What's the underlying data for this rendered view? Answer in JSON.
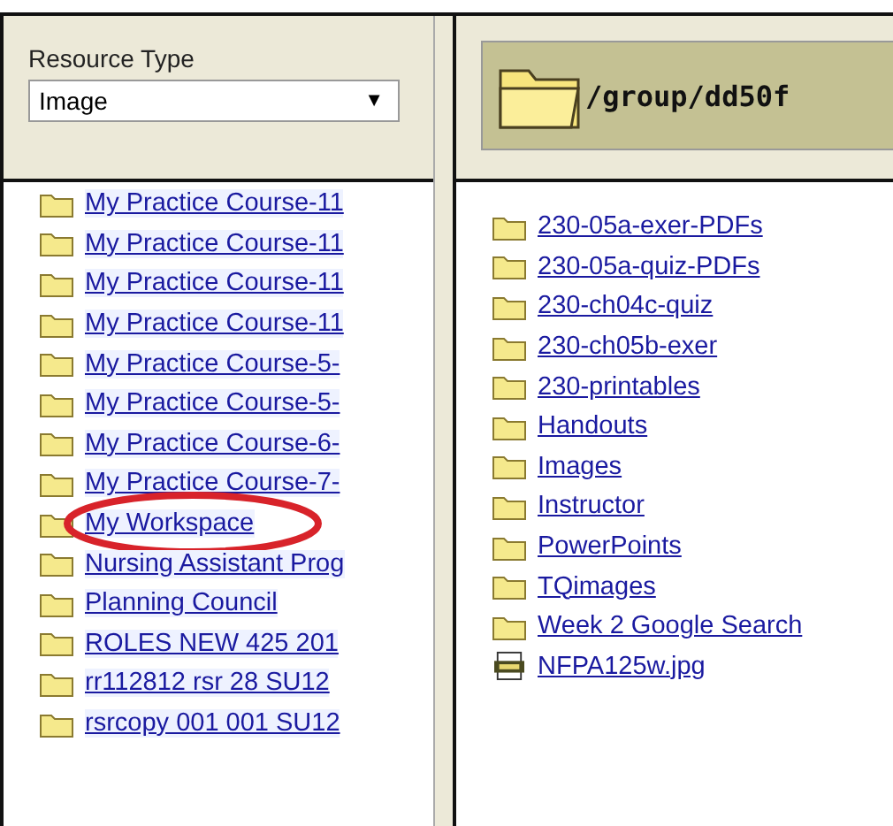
{
  "resource_type": {
    "label": "Resource Type",
    "value": "Image",
    "arrow": "▼"
  },
  "path": "/group/dd50f",
  "sidebar": {
    "items": [
      {
        "label": "My Practice Course-11",
        "circled": false
      },
      {
        "label": "My Practice Course-11",
        "circled": false
      },
      {
        "label": "My Practice Course-11",
        "circled": false
      },
      {
        "label": "My Practice Course-11",
        "circled": false
      },
      {
        "label": "My Practice Course-5-",
        "circled": false
      },
      {
        "label": "My Practice Course-5-",
        "circled": false
      },
      {
        "label": "My Practice Course-6-",
        "circled": false
      },
      {
        "label": "My Practice Course-7-",
        "circled": false
      },
      {
        "label": "My Workspace",
        "circled": true
      },
      {
        "label": "Nursing Assistant Prog",
        "circled": false
      },
      {
        "label": "Planning Council",
        "circled": false
      },
      {
        "label": "ROLES NEW 425 201",
        "circled": false
      },
      {
        "label": "rr112812 rsr 28 SU12",
        "circled": false
      },
      {
        "label": "rsrcopy 001 001 SU12",
        "circled": false
      }
    ]
  },
  "files": [
    {
      "kind": "folder",
      "label": "230-05a-exer-PDFs"
    },
    {
      "kind": "folder",
      "label": "230-05a-quiz-PDFs"
    },
    {
      "kind": "folder",
      "label": "230-ch04c-quiz"
    },
    {
      "kind": "folder",
      "label": "230-ch05b-exer"
    },
    {
      "kind": "folder",
      "label": "230-printables"
    },
    {
      "kind": "folder",
      "label": "Handouts"
    },
    {
      "kind": "folder",
      "label": "Images"
    },
    {
      "kind": "folder",
      "label": "Instructor"
    },
    {
      "kind": "folder",
      "label": "PowerPoints"
    },
    {
      "kind": "folder",
      "label": "TQimages"
    },
    {
      "kind": "folder",
      "label": "Week 2 Google Search"
    },
    {
      "kind": "image",
      "label": "NFPA125w.jpg"
    }
  ]
}
